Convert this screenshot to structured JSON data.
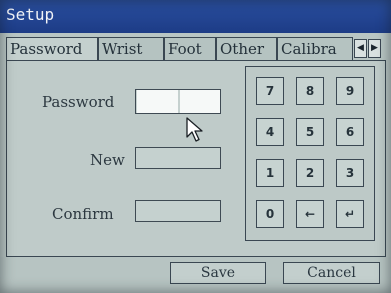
{
  "window": {
    "title": "Setup"
  },
  "tabs": [
    {
      "label": "Password",
      "active": true
    },
    {
      "label": "Wrist",
      "active": false
    },
    {
      "label": "Foot",
      "active": false
    },
    {
      "label": "Other",
      "active": false
    },
    {
      "label": "Calibra",
      "active": false
    }
  ],
  "tab_scroll": {
    "left_icon": "triangle-left-icon",
    "right_icon": "triangle-right-icon",
    "left_glyph": "◀",
    "right_glyph": "▶"
  },
  "form": {
    "password_label": "Password",
    "new_label": "New",
    "confirm_label": "Confirm"
  },
  "keypad": {
    "keys": [
      "7",
      "8",
      "9",
      "4",
      "5",
      "6",
      "1",
      "2",
      "3",
      "0",
      "←",
      "↵"
    ]
  },
  "footer": {
    "save_label": "Save",
    "cancel_label": "Cancel"
  },
  "colors": {
    "titlebar": "#1d3c86",
    "background": "#b9c6c4",
    "input_active": "#f6f9f8"
  }
}
